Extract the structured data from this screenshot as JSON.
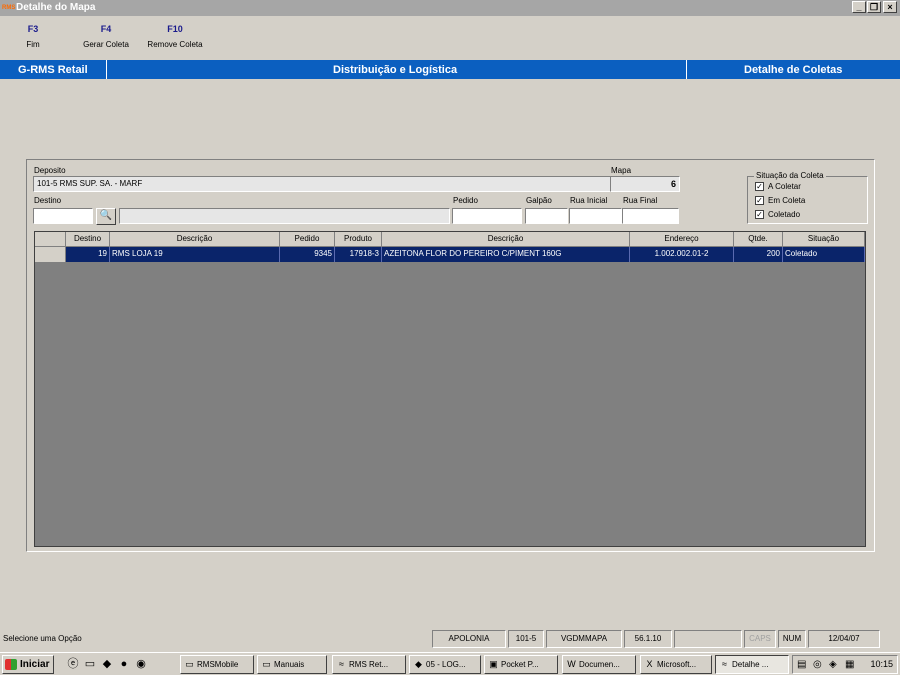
{
  "window": {
    "title": "Detalhe do Mapa",
    "app_icon": "RMS"
  },
  "fkeys": [
    {
      "key": "F3",
      "label": "Fim"
    },
    {
      "key": "F4",
      "label": "Gerar Coleta"
    },
    {
      "key": "F10",
      "label": "Remove Coleta"
    }
  ],
  "header": {
    "app": "G-RMS Retail",
    "module": "Distribuição e Logística",
    "screen": "Detalhe de Coletas"
  },
  "form": {
    "deposito_label": "Deposito",
    "deposito_value": "101-5  RMS SUP. SA. - MARF",
    "mapa_label": "Mapa",
    "mapa_value": "6",
    "destino_label": "Destino",
    "destino_value": "",
    "destino_desc": "",
    "pedido_label": "Pedido",
    "pedido_value": "",
    "galpao_label": "Galpão",
    "galpao_value": "",
    "rua_inicial_label": "Rua Inicial",
    "rua_inicial_value": "",
    "rua_final_label": "Rua Final",
    "rua_final_value": ""
  },
  "situacao": {
    "title": "Situação da Coleta",
    "options": [
      {
        "label": "A Coletar",
        "checked": true
      },
      {
        "label": "Em Coleta",
        "checked": true
      },
      {
        "label": "Coletado",
        "checked": true
      }
    ]
  },
  "table": {
    "columns": [
      "Destino",
      "Descrição",
      "Pedido",
      "Produto",
      "Descrição",
      "Endereço",
      "Qtde.",
      "Situação"
    ],
    "rows": [
      {
        "destino": "19",
        "descricao": "RMS LOJA 19",
        "pedido": "9345",
        "produto": "17918-3",
        "descricao_produto": "AZEITONA FLOR DO PEREIRO C/PIMENT 160G",
        "endereco": "1.002.002.01-2",
        "qtde": "200",
        "situacao": "Coletado"
      }
    ]
  },
  "statusbar": {
    "message": "Selecione uma Opção",
    "panels": [
      "APOLONIA",
      "101-5",
      "VGDMMAPA",
      "56.1.10",
      "",
      "CAPS",
      "NUM",
      "12/04/07"
    ]
  },
  "taskbar": {
    "start": "Iniciar",
    "buttons": [
      "RMSMobile",
      "Manuais",
      "RMS Ret...",
      "05 - LOG...",
      "Pocket P...",
      "Documen...",
      "Microsoft...",
      "Detalhe ..."
    ],
    "clock": "10:15"
  }
}
